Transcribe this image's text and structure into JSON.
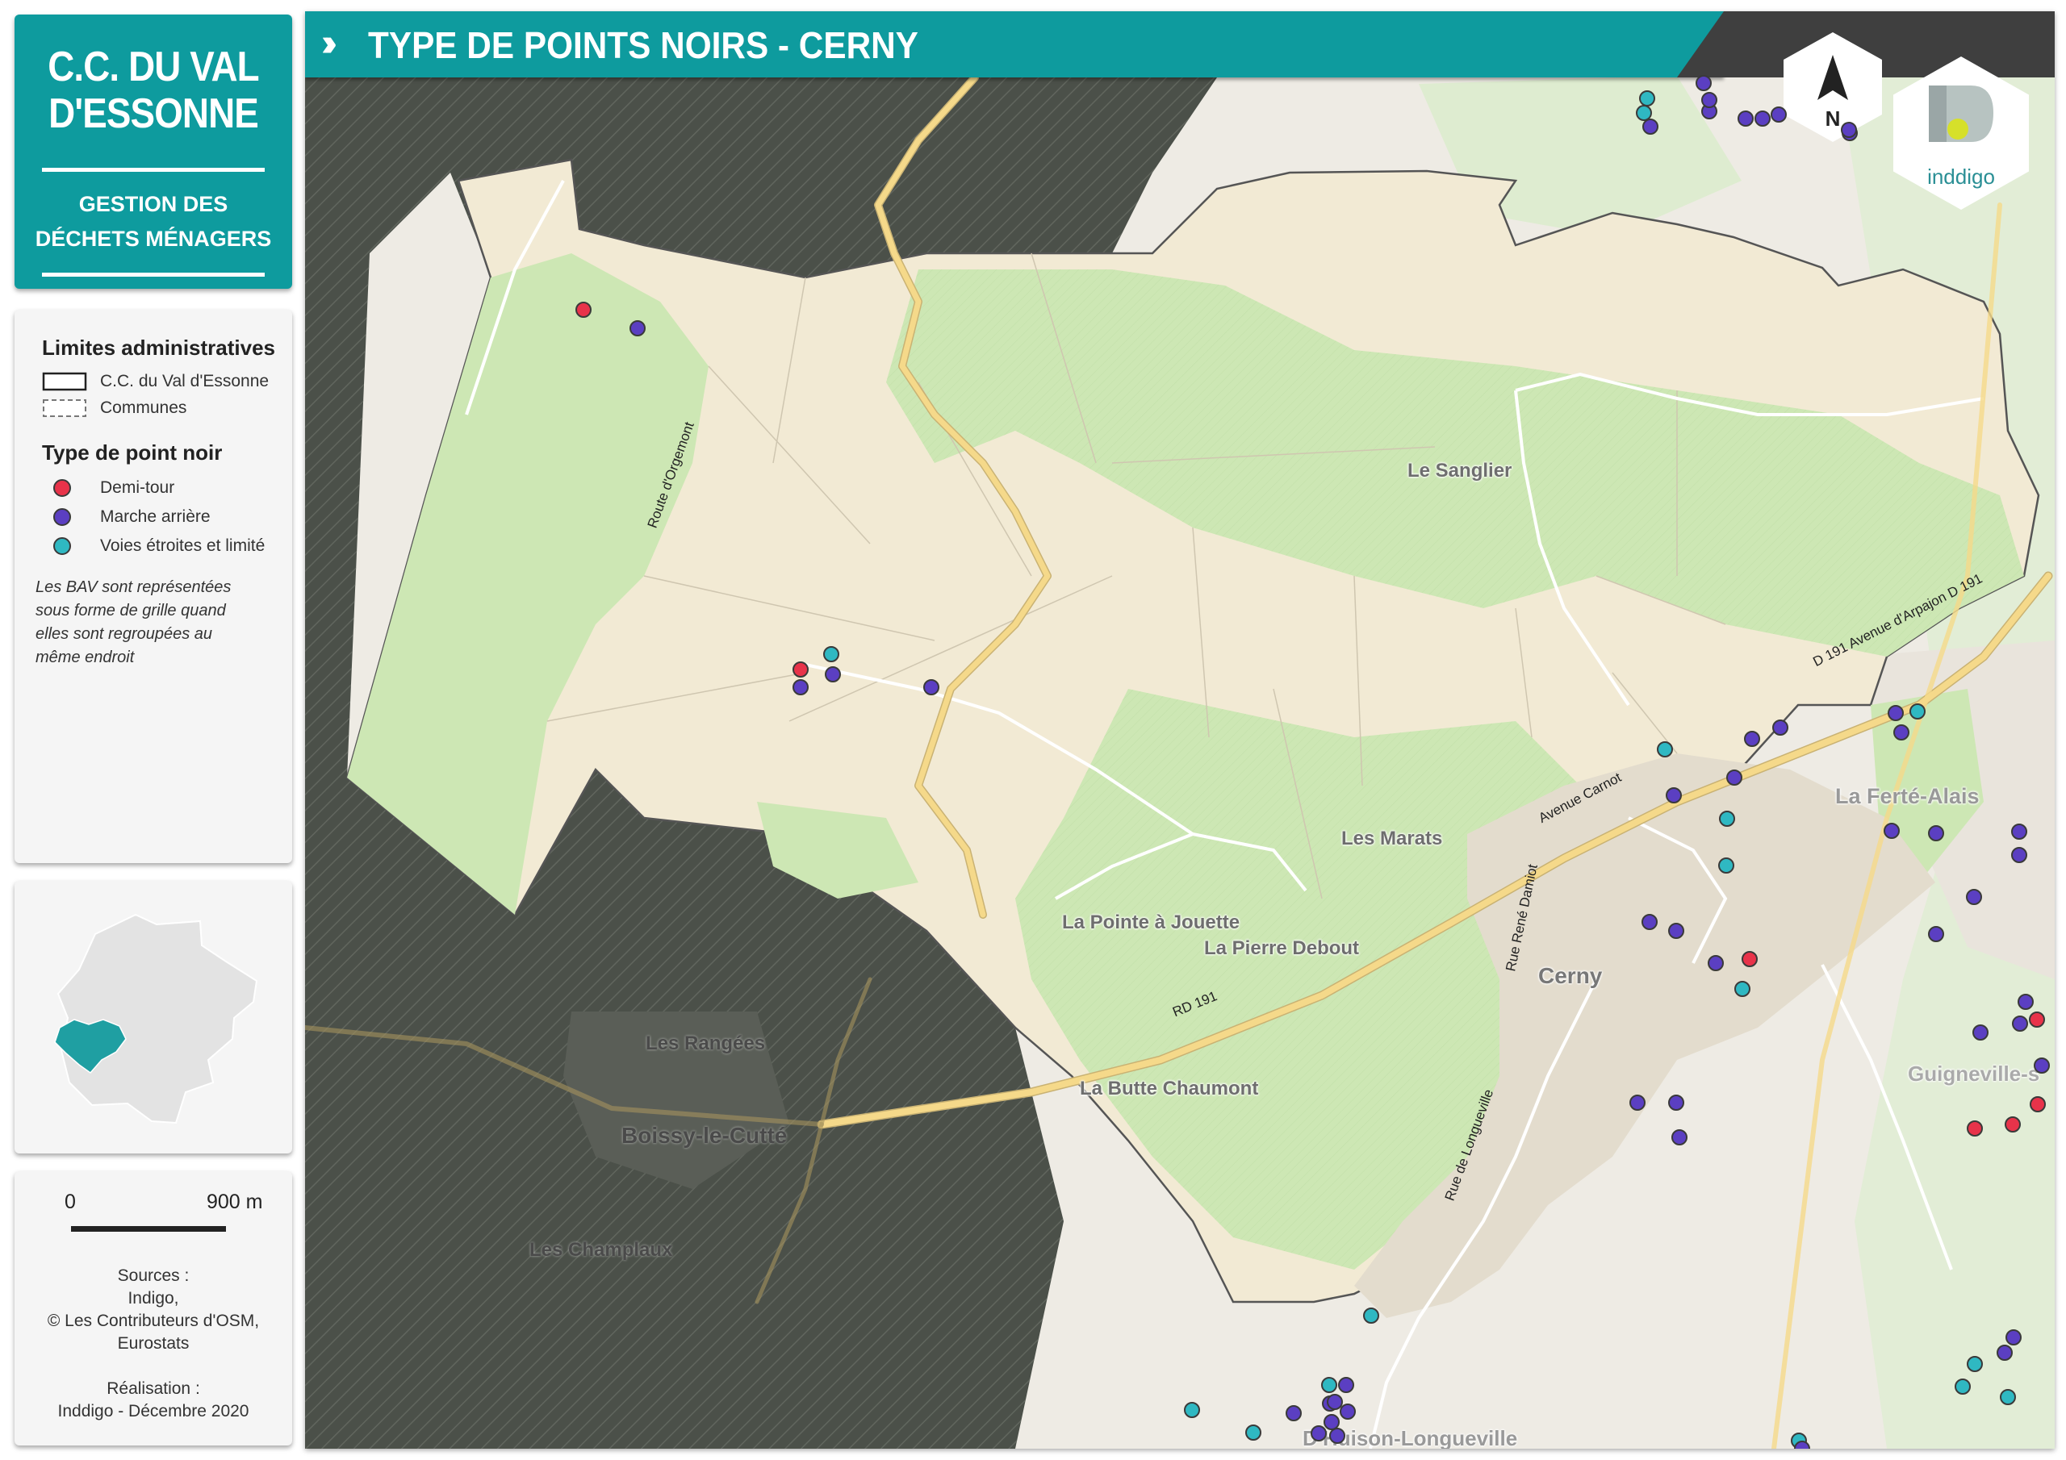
{
  "sidebar": {
    "org_title_line1": "C.C. DU VAL",
    "org_title_line2": "D'ESSONNE",
    "subtitle_line1": "GESTION DES",
    "subtitle_line2": "DÉCHETS MÉNAGERS"
  },
  "legend": {
    "section_admin": "Limites administratives",
    "admin_items": [
      {
        "label": "C.C. du Val d'Essonne",
        "style": "solid"
      },
      {
        "label": "Communes",
        "style": "dashed"
      }
    ],
    "section_points": "Type de point noir",
    "point_items": [
      {
        "label": "Demi-tour",
        "color": "#e8334a"
      },
      {
        "label": "Marche arrière",
        "color": "#5b3fc2"
      },
      {
        "label": "Voies étroites et limité",
        "color": "#2fb8c2"
      }
    ],
    "note": "Les BAV sont représentées sous forme de grille quand elles sont regroupées au même endroit"
  },
  "scale": {
    "left_label": "0",
    "right_label": "900 m"
  },
  "credits": {
    "sources_title": "Sources :",
    "sources_lines": [
      "Indigo,",
      "© Les Contributeurs d'OSM,",
      "Eurostats"
    ],
    "realisation_title": "Réalisation :",
    "realisation_line": "Inddigo - Décembre 2020"
  },
  "map": {
    "title": "TYPE DE POINTS NOIRS - CERNY",
    "north_label": "N",
    "logo_text": "inddigo",
    "place_labels": [
      "Le Sanglier",
      "La Ferté-Alais",
      "Les Marats",
      "La Pointe à Jouette",
      "La Pierre Debout",
      "Cerny",
      "La Butte Chaumont",
      "Les Rangées",
      "Boissy-le-Cutté",
      "Les Champlaux",
      "Guigneville-s",
      "D'Huison-Longueville"
    ],
    "road_labels": [
      "Route d'Orgemont",
      "Avenue Carnot",
      "D 191 Avenue d'Arpajon D 191",
      "RD 191",
      "Rue René Damiot",
      "Rue de Longueville"
    ],
    "colors": {
      "demi_tour": "#e8334a",
      "marche_arriere": "#5b3fc2",
      "voies_etroites": "#2fb8c2",
      "brand_teal": "#0e9b9e",
      "outside_mask": "#4b5049",
      "forest": "#cde7b4",
      "farmland": "#f2ead4"
    },
    "points": [
      {
        "type": "demi_tour"
      },
      {
        "type": "marche_arriere"
      },
      {
        "type": "voies_etroites"
      },
      {
        "type": "demi_tour"
      },
      {
        "type": "marche_arriere"
      },
      {
        "type": "marche_arriere"
      },
      {
        "type": "marche_arriere"
      },
      {
        "type": "voies_etroites"
      },
      {
        "type": "marche_arriere"
      },
      {
        "type": "marche_arriere"
      },
      {
        "type": "marche_arriere"
      },
      {
        "type": "voies_etroites"
      },
      {
        "type": "marche_arriere"
      },
      {
        "type": "marche_arriere"
      },
      {
        "type": "marche_arriere"
      },
      {
        "type": "marche_arriere"
      },
      {
        "type": "marche_arriere"
      },
      {
        "type": "marche_arriere"
      },
      {
        "type": "marche_arriere"
      },
      {
        "type": "marche_arriere"
      },
      {
        "type": "marche_arriere"
      },
      {
        "type": "marche_arriere"
      },
      {
        "type": "voies_etroites"
      },
      {
        "type": "voies_etroites"
      },
      {
        "type": "voies_etroites"
      },
      {
        "type": "marche_arriere"
      },
      {
        "type": "marche_arriere"
      },
      {
        "type": "demi_tour"
      },
      {
        "type": "marche_arriere"
      },
      {
        "type": "voies_etroites"
      },
      {
        "type": "marche_arriere"
      },
      {
        "type": "marche_arriere"
      },
      {
        "type": "marche_arriere"
      },
      {
        "type": "marche_arriere"
      },
      {
        "type": "marche_arriere"
      },
      {
        "type": "voies_etroites"
      },
      {
        "type": "marche_arriere"
      },
      {
        "type": "marche_arriere"
      },
      {
        "type": "marche_arriere"
      },
      {
        "type": "marche_arriere"
      },
      {
        "type": "marche_arriere"
      },
      {
        "type": "marche_arriere"
      },
      {
        "type": "marche_arriere"
      },
      {
        "type": "demi_tour"
      },
      {
        "type": "marche_arriere"
      },
      {
        "type": "marche_arriere"
      },
      {
        "type": "marche_arriere"
      },
      {
        "type": "demi_tour"
      },
      {
        "type": "demi_tour"
      },
      {
        "type": "demi_tour"
      },
      {
        "type": "marche_arriere"
      },
      {
        "type": "voies_etroites"
      },
      {
        "type": "marche_arriere"
      },
      {
        "type": "voies_etroites"
      },
      {
        "type": "voies_etroites"
      },
      {
        "type": "voies_etroites"
      },
      {
        "type": "voies_etroites"
      },
      {
        "type": "marche_arriere"
      },
      {
        "type": "marche_arriere"
      },
      {
        "type": "marche_arriere"
      },
      {
        "type": "marche_arriere"
      },
      {
        "type": "marche_arriere"
      },
      {
        "type": "marche_arriere"
      },
      {
        "type": "marche_arriere"
      },
      {
        "type": "marche_arriere"
      },
      {
        "type": "voies_etroites"
      },
      {
        "type": "voies_etroites"
      },
      {
        "type": "voies_etroites"
      },
      {
        "type": "marche_arriere"
      },
      {
        "type": "marche_arriere"
      },
      {
        "type": "marche_arriere"
      },
      {
        "type": "marche_arriere"
      },
      {
        "type": "marche_arriere"
      },
      {
        "type": "voies_etroites"
      },
      {
        "type": "marche_arriere"
      },
      {
        "type": "demi_tour"
      },
      {
        "type": "marche_arriere"
      },
      {
        "type": "voies_etroites"
      },
      {
        "type": "marche_arriere"
      },
      {
        "type": "voies_etroites"
      }
    ]
  }
}
